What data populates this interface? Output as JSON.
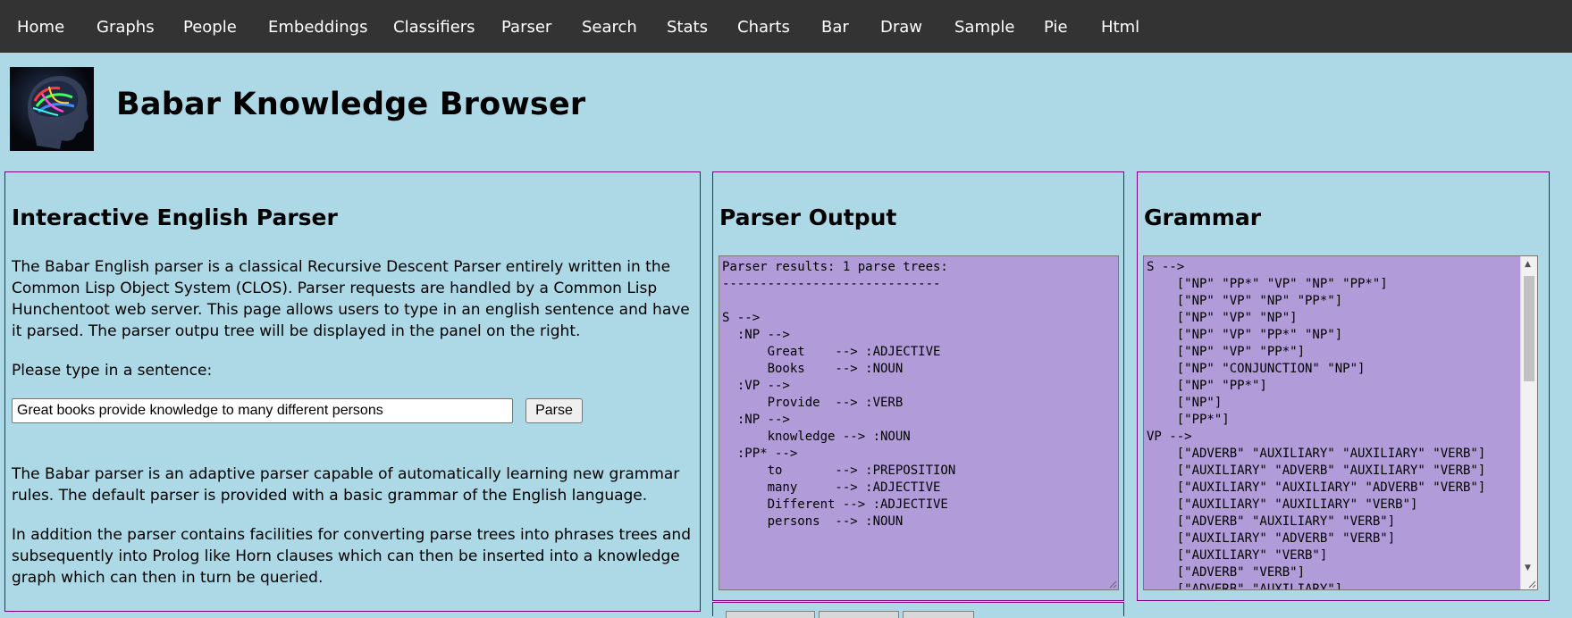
{
  "nav": [
    "Home",
    "Graphs",
    "People",
    "Embeddings",
    "Classifiers",
    "Parser",
    "Search",
    "Stats",
    "Charts",
    "Bar",
    "Draw",
    "Sample",
    "Pie",
    "Html"
  ],
  "page_title": "Babar Knowledge Browser",
  "parser_panel": {
    "heading": "Interactive English Parser",
    "intro": "The Babar English parser is a classical Recursive Descent Parser entirely written in the Common Lisp Object System (CLOS). Parser requests are handled by a Common Lisp Hunchentoot web server. This page allows users to type in an english sentence and have it parsed. The parser outpu tree will be displayed in the panel on the right.",
    "prompt": "Please type in a sentence:",
    "sentence_value": "Great books provide knowledge to many different persons",
    "parse_label": "Parse",
    "adaptive": "The Babar parser is an adaptive parser capable of automatically learning new grammar rules. The default parser is provided with a basic grammar of the English language.",
    "addition": "In addition the parser contains facilities for converting parse trees into phrases trees and subsequently into Prolog like Horn clauses which can then be inserted into a knowledge graph which can then in turn be queried."
  },
  "output_panel": {
    "heading": "Parser Output",
    "text": "Parser results: 1 parse trees:\n-----------------------------\n\nS -->\n  :NP -->\n      Great    --> :ADJECTIVE\n      Books    --> :NOUN\n  :VP -->\n      Provide  --> :VERB\n  :NP -->\n      knowledge --> :NOUN\n  :PP* -->\n      to       --> :PREPOSITION\n      many     --> :ADJECTIVE\n      Different --> :ADJECTIVE\n      persons  --> :NOUN"
  },
  "grammar_panel": {
    "heading": "Grammar",
    "text": "S -->\n    [\"NP\" \"PP*\" \"VP\" \"NP\" \"PP*\"]\n    [\"NP\" \"VP\" \"NP\" \"PP*\"]\n    [\"NP\" \"VP\" \"NP\"]\n    [\"NP\" \"VP\" \"PP*\" \"NP\"]\n    [\"NP\" \"VP\" \"PP*\"]\n    [\"NP\" \"CONJUNCTION\" \"NP\"]\n    [\"NP\" \"PP*\"]\n    [\"NP\"]\n    [\"PP*\"]\nVP -->\n    [\"ADVERB\" \"AUXILIARY\" \"AUXILIARY\" \"VERB\"]\n    [\"AUXILIARY\" \"ADVERB\" \"AUXILIARY\" \"VERB\"]\n    [\"AUXILIARY\" \"AUXILIARY\" \"ADVERB\" \"VERB\"]\n    [\"AUXILIARY\" \"AUXILIARY\" \"VERB\"]\n    [\"ADVERB\" \"AUXILIARY\" \"VERB\"]\n    [\"AUXILIARY\" \"ADVERB\" \"VERB\"]\n    [\"AUXILIARY\" \"VERB\"]\n    [\"ADVERB\" \"VERB\"]\n    [\"ADVERB\" \"AUXILIARY\"]"
  },
  "colors": {
    "nav_bg": "#333333",
    "page_bg": "#add8e6",
    "panel_border": "#800080",
    "output_bg": "#b19cd9"
  },
  "icons": [
    "brain-scan-logo",
    "resize-grip-icon",
    "scroll-up-arrow-icon",
    "scroll-down-arrow-icon"
  ]
}
